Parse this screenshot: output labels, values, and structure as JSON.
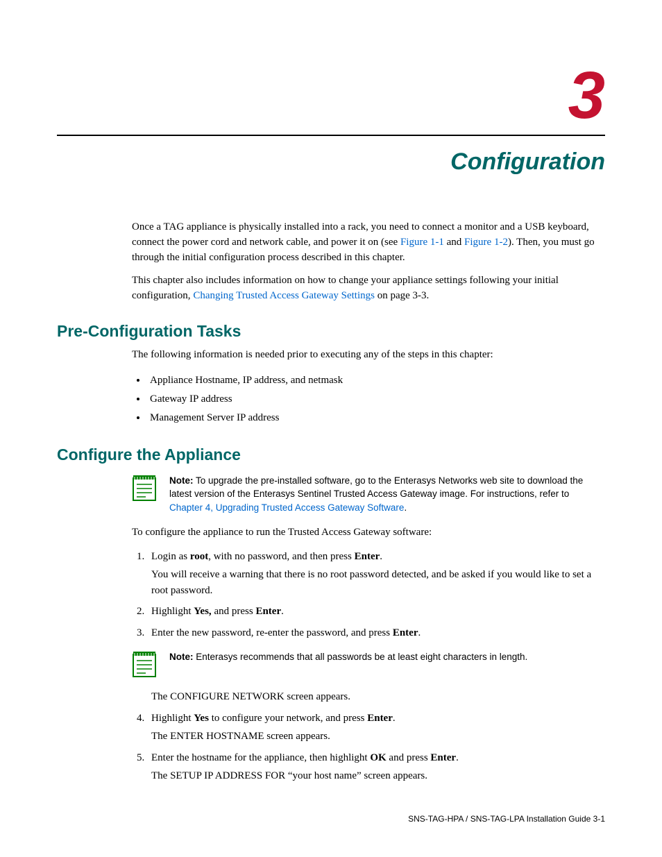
{
  "chapter": {
    "number": "3",
    "title": "Configuration"
  },
  "intro": {
    "p1_a": "Once a TAG appliance is physically installed into a rack, you need to connect a monitor and a USB keyboard, connect the power cord and network cable, and power it on (see ",
    "link1": "Figure 1-1",
    "p1_b": " and ",
    "link2": "Figure 1-2",
    "p1_c": "). Then, you must go through the initial configuration process described in this chapter.",
    "p2_a": "This chapter also includes information on how to change your appliance settings following your initial configuration, ",
    "link3": "Changing Trusted Access Gateway Settings",
    "p2_b": " on page 3-3."
  },
  "section1": {
    "heading": "Pre-Configuration Tasks",
    "lead": "The following information is needed prior to executing any of the steps in this chapter:",
    "bullets": [
      "Appliance Hostname, IP address, and netmask",
      "Gateway IP address",
      "Management Server IP address"
    ]
  },
  "section2": {
    "heading": "Configure the Appliance",
    "note1_label": "Note:",
    "note1_a": " To upgrade the pre-installed software, go to the Enterasys Networks web site to download the latest version of the Enterasys Sentinel Trusted Access Gateway image. For instructions, refer to ",
    "note1_link": "Chapter 4, Upgrading Trusted Access Gateway Software",
    "note1_b": ".",
    "lead": "To configure the appliance to run the Trusted Access Gateway software:",
    "step1_a": "Login as ",
    "step1_b": "root",
    "step1_c": ", with no password, and then press ",
    "step1_d": "Enter",
    "step1_e": ".",
    "step1_sub": "You will receive a warning that there is no root password detected, and be asked if you would like to set a root password.",
    "step2_a": "Highlight ",
    "step2_b": "Yes,",
    "step2_c": " and press ",
    "step2_d": "Enter",
    "step2_e": ".",
    "step3_a": "Enter the new password, re-enter the password, and press ",
    "step3_b": "Enter",
    "step3_c": ".",
    "note2_label": "Note:",
    "note2_text": " Enterasys recommends that all passwords be at least eight characters in length.",
    "step3_sub": "The CONFIGURE NETWORK screen appears.",
    "step4_a": "Highlight ",
    "step4_b": "Yes",
    "step4_c": " to configure your network, and press ",
    "step4_d": "Enter",
    "step4_e": ".",
    "step4_sub": "The ENTER HOSTNAME screen appears.",
    "step5_a": "Enter the hostname for the appliance, then highlight ",
    "step5_b": "OK",
    "step5_c": " and press ",
    "step5_d": "Enter",
    "step5_e": ".",
    "step5_sub": "The SETUP IP ADDRESS FOR “your host name” screen appears."
  },
  "footer": {
    "text": "SNS-TAG-HPA / SNS-TAG-LPA Installation Guide   3-1"
  }
}
